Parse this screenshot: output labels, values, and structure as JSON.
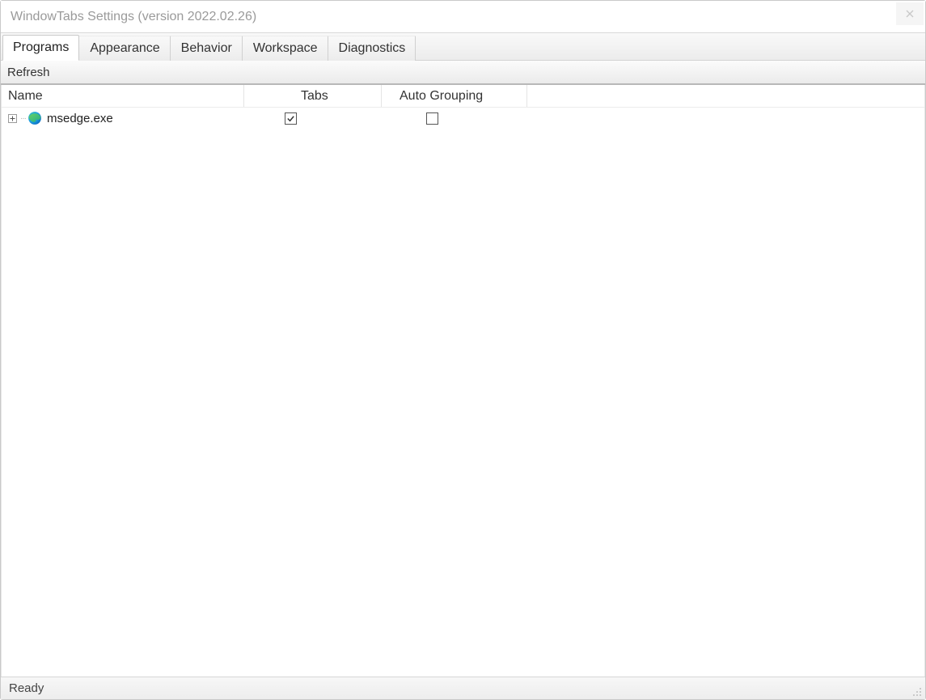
{
  "window": {
    "title": "WindowTabs Settings (version 2022.02.26)"
  },
  "tabs": [
    {
      "label": "Programs",
      "active": true
    },
    {
      "label": "Appearance",
      "active": false
    },
    {
      "label": "Behavior",
      "active": false
    },
    {
      "label": "Workspace",
      "active": false
    },
    {
      "label": "Diagnostics",
      "active": false
    }
  ],
  "toolbar": {
    "refresh_label": "Refresh"
  },
  "table": {
    "columns": {
      "name": "Name",
      "tabs": "Tabs",
      "auto_grouping": "Auto Grouping"
    },
    "rows": [
      {
        "name": "msedge.exe",
        "icon": "edge-icon",
        "tabs_checked": true,
        "auto_grouping_checked": false,
        "expandable": true
      }
    ]
  },
  "status": {
    "text": "Ready"
  }
}
